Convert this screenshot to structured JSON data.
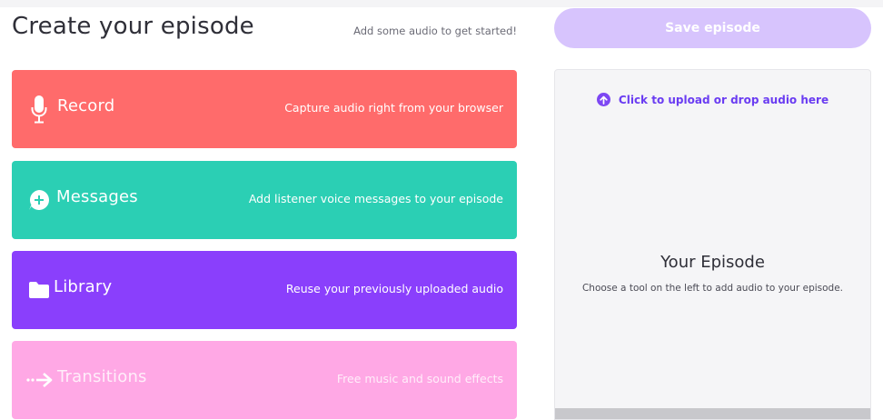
{
  "header": {
    "title": "Create your episode",
    "hint": "Add some audio to get started!"
  },
  "tools": [
    {
      "label": "Record",
      "description": "Capture audio right from your browser",
      "icon": "microphone-icon",
      "color": "#ff6b6b"
    },
    {
      "label": "Messages",
      "description": "Add listener voice messages to your episode",
      "icon": "message-plus-icon",
      "color": "#2bcfb4"
    },
    {
      "label": "Library",
      "description": "Reuse your previously uploaded audio",
      "icon": "folder-icon",
      "color": "#8a3ffc"
    },
    {
      "label": "Transitions",
      "description": "Free music and sound effects",
      "icon": "arrow-right-icon",
      "color": "#ffa8e5"
    }
  ],
  "save_button": {
    "label": "Save episode",
    "state": "disabled"
  },
  "episode_panel": {
    "upload_label": "Click to upload or drop audio here",
    "upload_icon": "upload-arrow-icon",
    "title": "Your Episode",
    "subtitle": "Choose a tool on the left to add audio to your episode."
  },
  "colors": {
    "accent": "#7d47f3",
    "save_disabled": "#d7c4fd"
  }
}
